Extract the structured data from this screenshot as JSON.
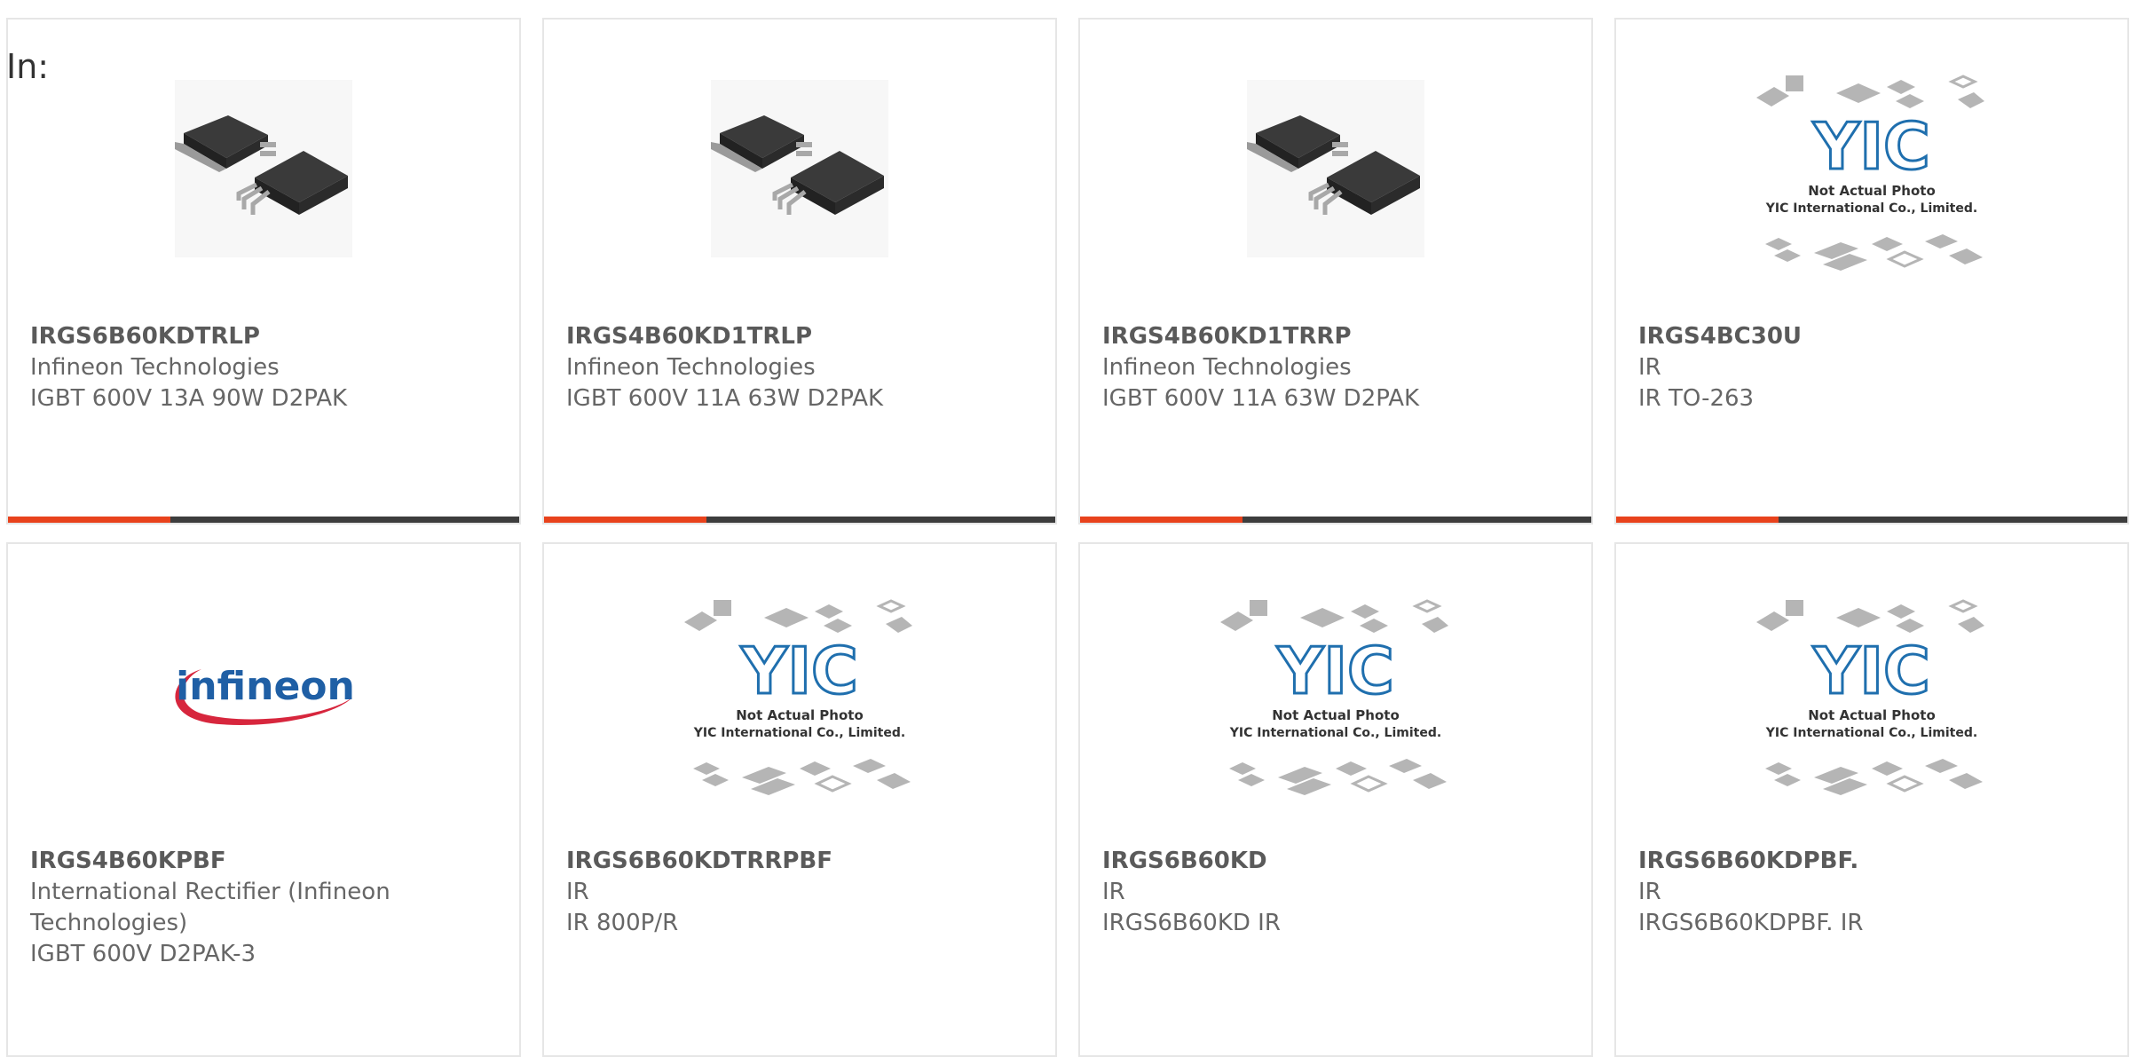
{
  "heading": "In:",
  "colors": {
    "accent": "#e8421c",
    "bar_dark": "#3d3d3d",
    "infineon_blue": "#1f5fa5",
    "infineon_red": "#d7263d",
    "yic_blue": "#1f6fae"
  },
  "products": [
    {
      "part": "IRGS6B60KDTRLP",
      "maker": "Infineon Technologies",
      "desc": "IGBT 600V 13A 90W D2PAK",
      "image": "d2pak-photo",
      "has_bar": true
    },
    {
      "part": "IRGS4B60KD1TRLP",
      "maker": "Infineon Technologies",
      "desc": "IGBT 600V 11A 63W D2PAK",
      "image": "d2pak-photo",
      "has_bar": true
    },
    {
      "part": "IRGS4B60KD1TRRP",
      "maker": "Infineon Technologies",
      "desc": "IGBT 600V 11A 63W D2PAK",
      "image": "d2pak-photo",
      "has_bar": true
    },
    {
      "part": "IRGS4BC30U",
      "maker": "IR",
      "desc": "IR TO-263",
      "image": "yic-placeholder",
      "has_bar": true
    },
    {
      "part": "IRGS4B60KPBF",
      "maker": "International Rectifier (Infineon Technologies)",
      "desc": "IGBT 600V D2PAK-3",
      "image": "infineon-logo",
      "has_bar": false
    },
    {
      "part": "IRGS6B60KDTRRPBF",
      "maker": "IR",
      "desc": "IR 800P/R",
      "image": "yic-placeholder",
      "has_bar": false
    },
    {
      "part": "IRGS6B60KD",
      "maker": "IR",
      "desc": "IRGS6B60KD IR",
      "image": "yic-placeholder",
      "has_bar": false
    },
    {
      "part": "IRGS6B60KDPBF.",
      "maker": "IR",
      "desc": "IRGS6B60KDPBF. IR",
      "image": "yic-placeholder",
      "has_bar": false
    }
  ],
  "placeholder": {
    "line1": "Not Actual Photo",
    "line2": "YIC International Co., Limited.",
    "logo_text": "YIC"
  },
  "infineon_logo_text": "infineon"
}
